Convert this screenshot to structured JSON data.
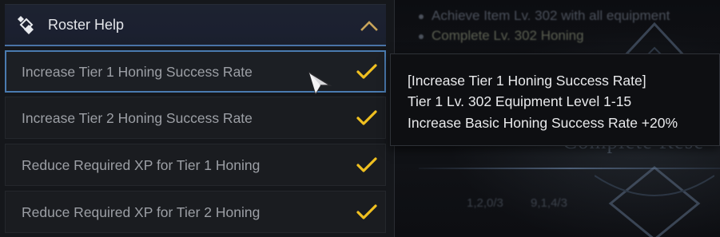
{
  "panel": {
    "title": "Roster Help",
    "header_icon": "roster-help-icon",
    "collapse_icon": "chevron-up-icon",
    "items": [
      {
        "label": "Increase Tier 1 Honing Success Rate",
        "completed": true,
        "selected": true
      },
      {
        "label": "Increase Tier 2 Honing Success Rate",
        "completed": true,
        "selected": false
      },
      {
        "label": "Reduce Required XP for Tier 1 Honing",
        "completed": true,
        "selected": false
      },
      {
        "label": "Reduce Required XP for Tier 2 Honing",
        "completed": true,
        "selected": false
      }
    ]
  },
  "tooltip": {
    "title": "[Increase Tier 1 Honing Success Rate]",
    "requirement": "Tier 1 Lv. 302 Equipment Level 1-15",
    "effect": "Increase Basic Honing Success Rate +20%"
  },
  "background": {
    "objectives": [
      "Achieve Item Lv. 302 with all equipment",
      "Complete Lv. 302 Honing"
    ],
    "heading": "Complete Rese",
    "values": [
      "1,2,0/3",
      "9,1,4/3"
    ]
  },
  "colors": {
    "accent": "#4a7bb0",
    "check": "#f0c020",
    "panel_bg": "#15171b",
    "header_bg": "#1d2230"
  }
}
